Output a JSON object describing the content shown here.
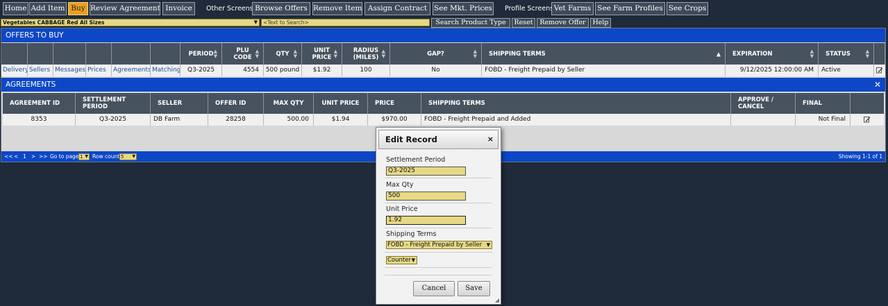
{
  "nav": {
    "home": "Home",
    "add_item": "Add Item",
    "buy": "Buy",
    "review_agreement": "Review Agreement",
    "invoice": "Invoice",
    "other_label": "Other Screens:",
    "browse_offers": "Browse Offers",
    "remove_item": "Remove Item",
    "assign_contract": "Assign Contract",
    "see_mkt_prices": "See Mkt. Prices",
    "profile_label": "Profile Screens:",
    "vet_farms": "Vet Farms",
    "see_farm_profiles": "See Farm Profiles",
    "see_crops": "See Crops"
  },
  "search": {
    "category": "Vegetables CABBAGE Red All Sizes",
    "placeholder": "<Text to Search>",
    "search_product_type": "Search Product Type",
    "reset": "Reset",
    "remove_offer": "Remove Offer",
    "help": "Help"
  },
  "offers": {
    "title": "OFFERS TO BUY",
    "headers": {
      "period": "PERIOD",
      "plu": "PLU CODE",
      "qty": "QTY",
      "unit_price": "UNIT PRICE",
      "radius": "RADIUS (MILES)",
      "gap": "GAP?",
      "shipping": "SHIPPING TERMS",
      "expiration": "EXPIRATION",
      "status": "STATUS"
    },
    "links": {
      "delivery": "Delivery",
      "sellers": "Sellers",
      "messages": "Messages",
      "prices": "Prices",
      "agreements": "Agreements",
      "matching": "Matching"
    },
    "row": {
      "period": "Q3-2025",
      "plu": "4554",
      "qty": "500 pound",
      "unit_price": "$1.92",
      "radius": "100",
      "gap": "No",
      "shipping": "FOBD - Freight Prepaid by Seller",
      "expiration": "9/12/2025 12:00:00 AM",
      "status": "Active"
    }
  },
  "agreements": {
    "title": "AGREEMENTS",
    "headers": {
      "agreement_id": "AGREEMENT ID",
      "settlement": "SETTLEMENT PERIOD",
      "seller": "SELLER",
      "offer_id": "OFFER ID",
      "max_qty": "MAX QTY",
      "unit_price": "UNIT PRICE",
      "price": "PRICE",
      "shipping": "SHIPPING TERMS",
      "approve": "APPROVE / CANCEL",
      "final": "FINAL"
    },
    "row": {
      "agreement_id": "8353",
      "settlement": "Q3-2025",
      "seller": "DB Farm",
      "offer_id": "28258",
      "max_qty": "500.00",
      "unit_price": "$1.94",
      "price": "$970.00",
      "shipping": "FOBD - Freight Prepaid and Added",
      "approve": "",
      "final": "Not Final"
    }
  },
  "pager": {
    "first": "<<",
    "prev": "<",
    "page": "1",
    "next": ">",
    "last": ">>",
    "goto_label": "Go to page:",
    "goto_value": "1",
    "rowcount_label": "Row count:",
    "rowcount_value": "5",
    "showing": "Showing 1-1 of 1"
  },
  "dialog": {
    "title": "Edit Record",
    "settlement_label": "Settlement Period",
    "settlement_value": "Q3-2025",
    "maxqty_label": "Max Qty",
    "maxqty_value": "500",
    "unitprice_label": "Unit Price",
    "unitprice_value": "1.92",
    "shipping_label": "Shipping Terms",
    "shipping_value": "FOBD - Freight Prepaid by Seller",
    "counter_value": "Counter",
    "cancel": "Cancel",
    "save": "Save"
  }
}
